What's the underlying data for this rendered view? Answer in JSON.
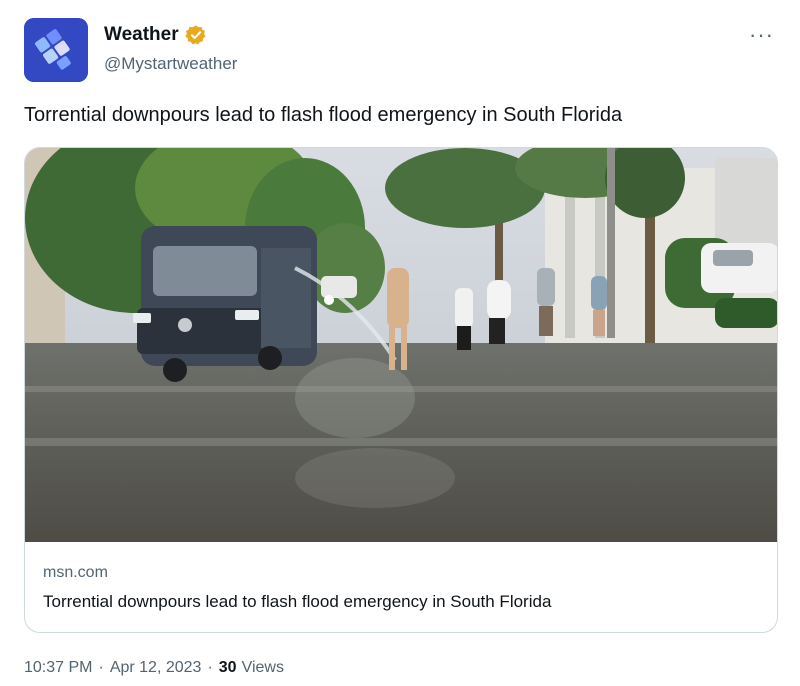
{
  "author": {
    "display_name": "Weather",
    "handle": "@Mystartweather",
    "avatar_icon": "weather-logo-icon",
    "verified_icon": "verified-badge-icon",
    "verified_color": "#e8a91c"
  },
  "more_icon": "more-options-icon",
  "more_glyph": "···",
  "tweet": {
    "text": "Torrential downpours lead to flash flood emergency in South Florida"
  },
  "card": {
    "domain": "msn.com",
    "title": "Torrential downpours lead to flash flood emergency in South Florida",
    "image_description_icon": "flooded-street-photo"
  },
  "meta": {
    "time": "10:37 PM",
    "separator": "·",
    "date": "Apr 12, 2023",
    "views_count": "30",
    "views_label": "Views"
  }
}
